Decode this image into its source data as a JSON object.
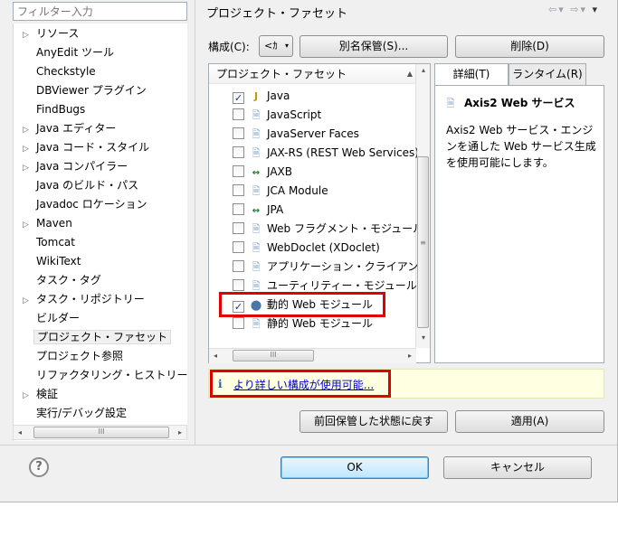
{
  "filter": {
    "placeholder": "フィルター入力"
  },
  "tree": {
    "items": [
      {
        "label": "リソース",
        "expandable": true
      },
      {
        "label": "AnyEdit ツール",
        "expandable": false
      },
      {
        "label": "Checkstyle",
        "expandable": false
      },
      {
        "label": "DBViewer プラグイン",
        "expandable": false
      },
      {
        "label": "FindBugs",
        "expandable": false
      },
      {
        "label": "Java エディター",
        "expandable": true
      },
      {
        "label": "Java コード・スタイル",
        "expandable": true
      },
      {
        "label": "Java コンパイラー",
        "expandable": true
      },
      {
        "label": "Java のビルド・パス",
        "expandable": false
      },
      {
        "label": "Javadoc ロケーション",
        "expandable": false
      },
      {
        "label": "Maven",
        "expandable": true
      },
      {
        "label": "Tomcat",
        "expandable": false
      },
      {
        "label": "WikiText",
        "expandable": false
      },
      {
        "label": "タスク・タグ",
        "expandable": false
      },
      {
        "label": "タスク・リポジトリー",
        "expandable": true
      },
      {
        "label": "ビルダー",
        "expandable": false
      },
      {
        "label": "プロジェクト・ファセット",
        "expandable": false,
        "selected": true
      },
      {
        "label": "プロジェクト参照",
        "expandable": false
      },
      {
        "label": "リファクタリング・ヒストリー",
        "expandable": false
      },
      {
        "label": "検証",
        "expandable": true
      },
      {
        "label": "実行/デバッグ設定",
        "expandable": false
      }
    ],
    "arrow_glyph": "▷"
  },
  "page": {
    "title": "プロジェクト・ファセット",
    "nav_back": "⇦",
    "nav_fwd": "⇨",
    "nav_dd": "▾",
    "nav_menu": "▾"
  },
  "config": {
    "label": "構成(C):",
    "combo_value": "<ｶ",
    "save_as": "別名保管(S)...",
    "delete": "削除(D)"
  },
  "facets": {
    "header": "プロジェクト・ファセット",
    "rows": [
      {
        "label": "Java",
        "checked": true,
        "icon": "java"
      },
      {
        "label": "JavaScript",
        "checked": false,
        "icon": "doc"
      },
      {
        "label": "JavaServer Faces",
        "checked": false,
        "icon": "doc"
      },
      {
        "label": "JAX-RS (REST Web Services)",
        "checked": false,
        "icon": "doc"
      },
      {
        "label": "JAXB",
        "checked": false,
        "icon": "xml"
      },
      {
        "label": "JCA Module",
        "checked": false,
        "icon": "doc"
      },
      {
        "label": "JPA",
        "checked": false,
        "icon": "xml"
      },
      {
        "label": "Web フラグメント・モジュール",
        "checked": false,
        "icon": "doc"
      },
      {
        "label": "WebDoclet (XDoclet)",
        "checked": false,
        "icon": "doc"
      },
      {
        "label": "アプリケーション・クライアント",
        "checked": false,
        "icon": "doc"
      },
      {
        "label": "ユーティリティー・モジュール",
        "checked": false,
        "icon": "doc"
      },
      {
        "label": "動的 Web モジュール",
        "checked": true,
        "icon": "web"
      },
      {
        "label": "静的 Web モジュール",
        "checked": false,
        "icon": "doc"
      }
    ]
  },
  "tabs": [
    {
      "label": "詳細(T)",
      "active": true
    },
    {
      "label": "ランタイム(R)",
      "active": false
    }
  ],
  "detail": {
    "title": "Axis2 Web サービス",
    "description": "Axis2 Web サービス・エンジンを通した Web サービス生成を使用可能にします。"
  },
  "info": {
    "icon": "i",
    "link": "より詳しい構成が使用可能..."
  },
  "buttons": {
    "restore": "前回保管した状態に戻す",
    "apply": "適用(A)",
    "ok": "OK",
    "cancel": "キャンセル",
    "help": "?"
  },
  "glyphs": {
    "check": "✓",
    "scroll_left": "◂",
    "scroll_right": "▸",
    "scroll_up": "▴",
    "scroll_down": "▾",
    "grip_h": "III",
    "grip_v": "≡",
    "sort": "▲",
    "combo_dd": "▾",
    "java_icon": "J",
    "doc_icon": "🗎",
    "xml_icon": "↔",
    "web_icon": "⬤"
  }
}
